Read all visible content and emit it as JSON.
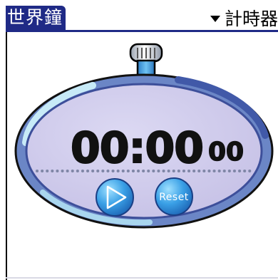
{
  "app": {
    "title": "世界鐘",
    "mode": "計時器"
  },
  "stopwatch": {
    "time_main": "00:00",
    "time_hundredths": "00",
    "reset_label": "Reset"
  },
  "colors": {
    "title_bar": "#1f2a86",
    "face": "#cdc9ea",
    "rim_dark": "#4f63b8",
    "rim_light": "#9fd0e6",
    "button": "#3aa0e6",
    "digits": "#111111"
  },
  "icons": {
    "mode_dropdown": "triangle-down-icon",
    "start": "play-icon",
    "crown": "stopwatch-crown-icon"
  }
}
